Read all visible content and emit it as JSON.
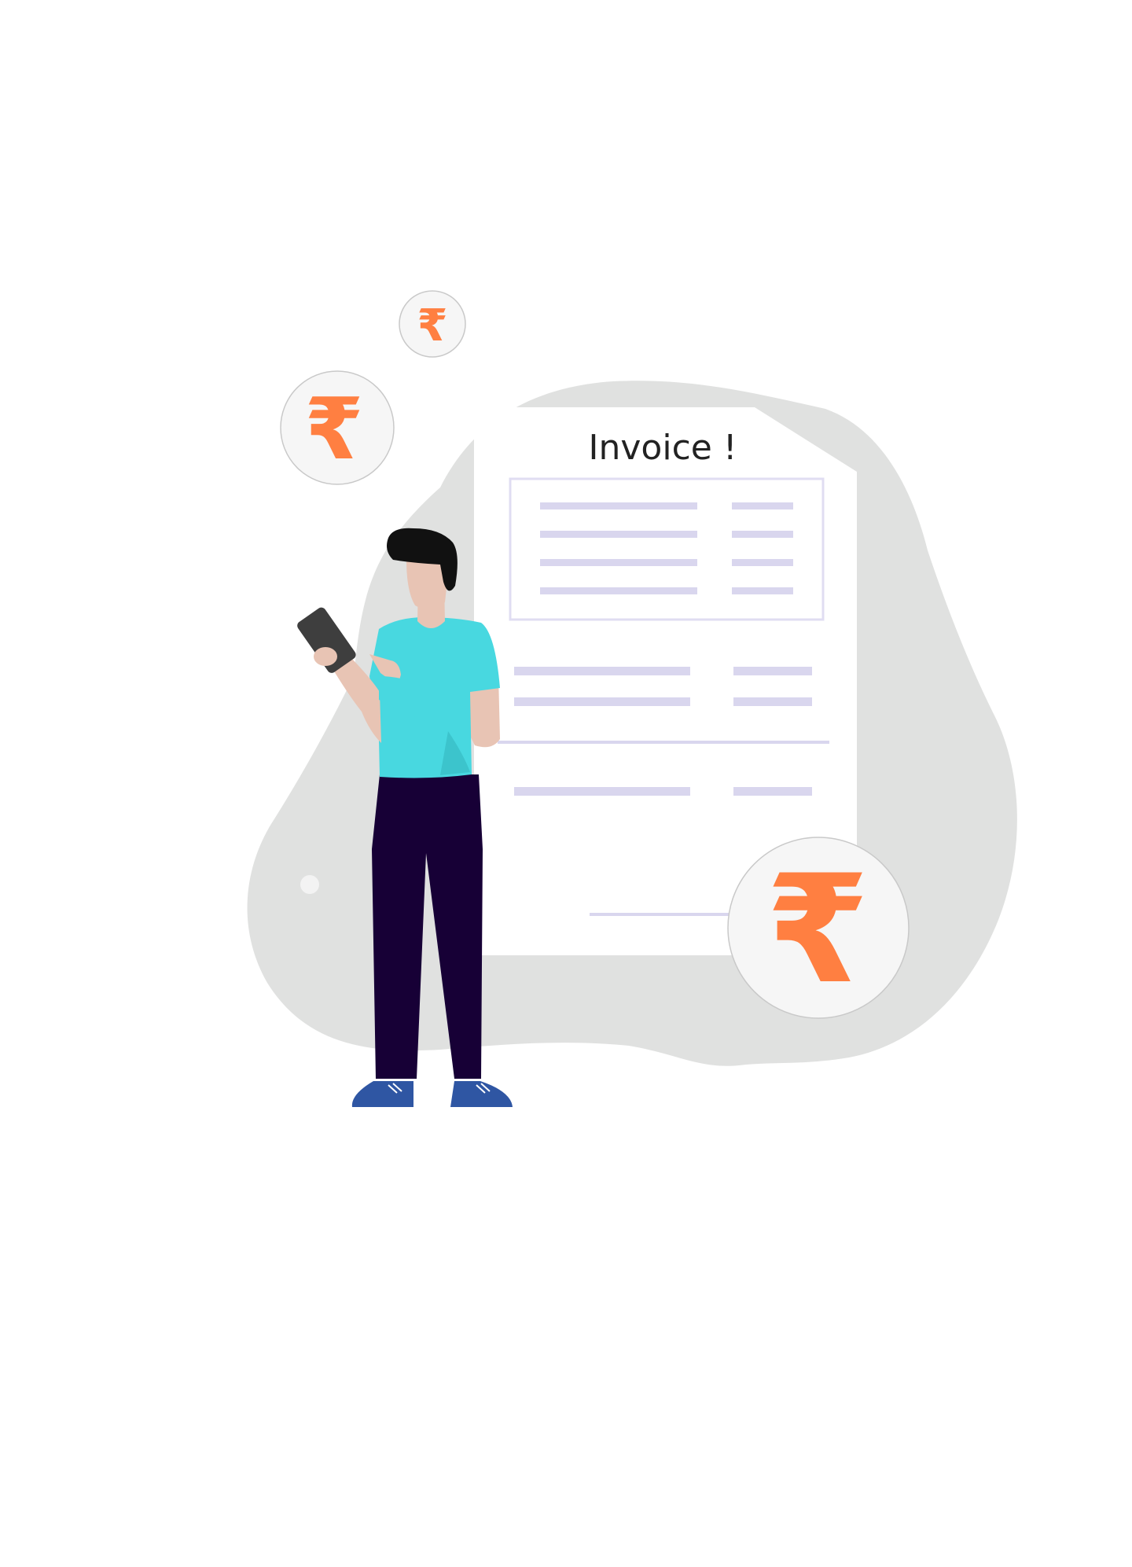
{
  "invoice": {
    "title": "Invoice !"
  },
  "icons": {
    "currency": "rupee-icon",
    "currency_symbol": "₹",
    "person": "person-illustration",
    "phone": "smartphone-icon",
    "document": "invoice-document"
  },
  "colors": {
    "accent": "#ff7f41",
    "blob": "#e0e1e0",
    "invoice_line": "#d9d6ee",
    "shirt": "#48d8e0",
    "pants": "#170036",
    "shoes": "#2f56a3",
    "skin": "#e8c4b4",
    "hair": "#111111",
    "phone": "#3e3e3e"
  }
}
